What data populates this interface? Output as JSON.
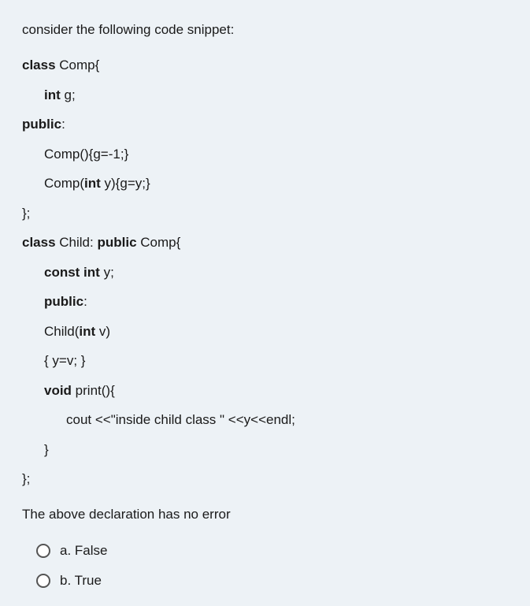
{
  "intro": "consider the following code snippet:",
  "code": {
    "l1": {
      "kw1": "class",
      "t1": " Comp{"
    },
    "l2": {
      "kw1": "int",
      "t1": " g;"
    },
    "l3": {
      "kw1": "public",
      "t1": ":"
    },
    "l4": {
      "t1": "Comp(){g=-1;}"
    },
    "l5": {
      "t1": "Comp(",
      "kw1": "int",
      "t2": " y){g=y;}"
    },
    "l6": {
      "t1": "};"
    },
    "l7": {
      "kw1": "class",
      "t1": " Child: ",
      "kw2": "public",
      "t2": " Comp{"
    },
    "l8": {
      "kw1": "const int",
      "t1": " y;"
    },
    "l9": {
      "kw1": "public",
      "t1": ":"
    },
    "l10": {
      "t1": "Child(",
      "kw1": "int",
      "t2": " v)"
    },
    "l11": {
      "t1": "{ y=v; }"
    },
    "l12": {
      "kw1": "void",
      "t1": " print(){"
    },
    "l13": {
      "t1": "cout <<\"inside child class \" <<y<<endl;"
    },
    "l14": {
      "t1": "}"
    },
    "l15": {
      "t1": "};"
    }
  },
  "conclusion": "The above declaration has no error",
  "options": {
    "a": "a. False",
    "b": "b. True"
  }
}
